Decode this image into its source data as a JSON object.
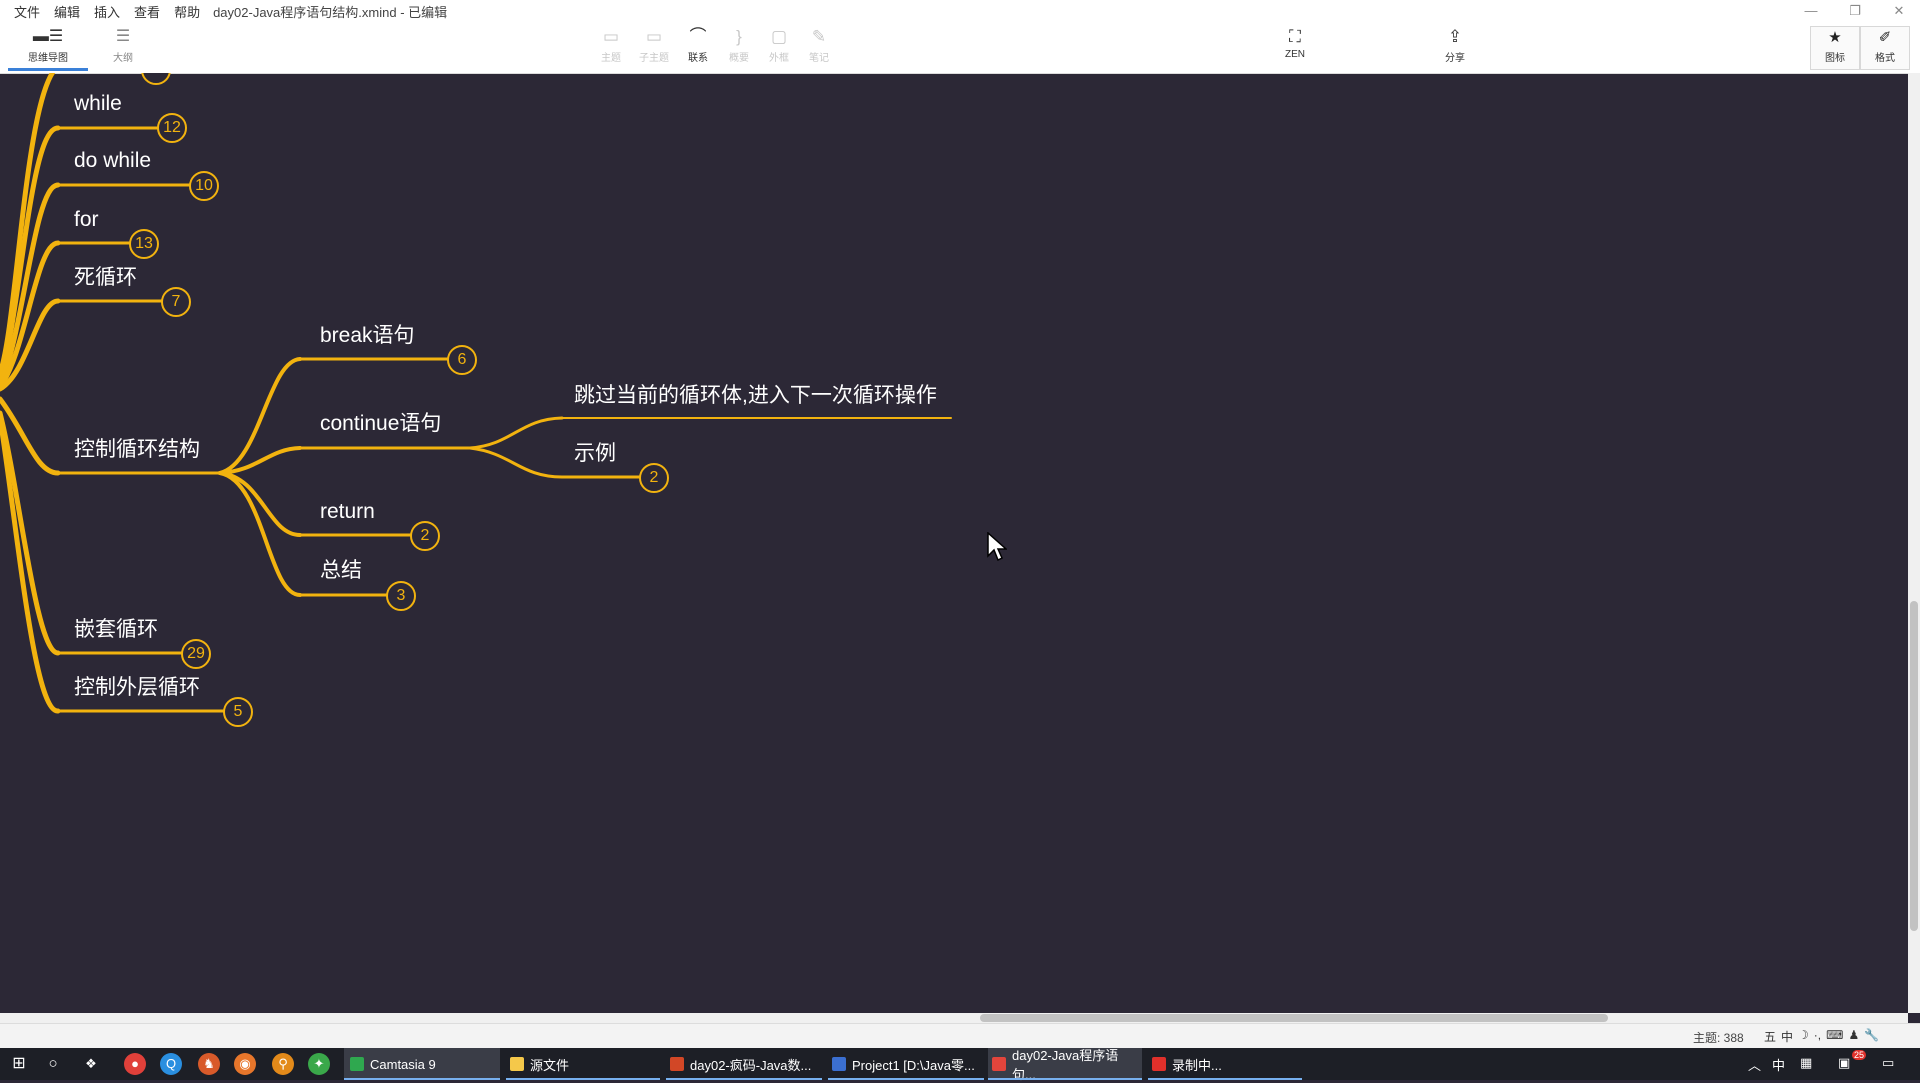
{
  "app": {
    "menu": [
      "文件",
      "编辑",
      "插入",
      "查看",
      "帮助"
    ],
    "doc_title": "day02-Java程序语句结构.xmind - 已编辑"
  },
  "toolbar": {
    "view_tabs": [
      {
        "label": "思维导图",
        "icon": "mindmap-icon",
        "active": true
      },
      {
        "label": "大纲",
        "icon": "outline-icon",
        "active": false
      }
    ],
    "tools": [
      {
        "label": "主题",
        "icon": "topic-icon",
        "enabled": false
      },
      {
        "label": "子主题",
        "icon": "subtopic-icon",
        "enabled": false
      },
      {
        "label": "联系",
        "icon": "relationship-icon",
        "enabled": true
      },
      {
        "label": "概要",
        "icon": "summary-icon",
        "enabled": false
      },
      {
        "label": "外框",
        "icon": "boundary-icon",
        "enabled": false
      },
      {
        "label": "笔记",
        "icon": "notes-icon",
        "enabled": false
      }
    ],
    "zen_label": "ZEN",
    "share_label": "分享",
    "icons_label": "图标",
    "format_label": "格式"
  },
  "mindmap": {
    "branch_color": "#f2b30f",
    "background": "#2c2836",
    "nodes": [
      {
        "id": "while",
        "label": "while",
        "badge": "12"
      },
      {
        "id": "dowhile",
        "label": "do while",
        "badge": "10"
      },
      {
        "id": "for",
        "label": "for",
        "badge": "13"
      },
      {
        "id": "deadloop",
        "label": "死循环",
        "badge": "7"
      },
      {
        "id": "control",
        "label": "控制循环结构",
        "badge": ""
      },
      {
        "id": "break",
        "label": "break语句",
        "badge": "6"
      },
      {
        "id": "continue",
        "label": "continue语句",
        "badge": ""
      },
      {
        "id": "skip",
        "label": "跳过当前的循环体,进入下一次循环操作",
        "badge": ""
      },
      {
        "id": "example",
        "label": "示例",
        "badge": "2"
      },
      {
        "id": "return",
        "label": "return",
        "badge": "2"
      },
      {
        "id": "summary",
        "label": "总结",
        "badge": "3"
      },
      {
        "id": "nested",
        "label": "嵌套循环",
        "badge": "29"
      },
      {
        "id": "outer",
        "label": "控制外层循环",
        "badge": "5"
      }
    ]
  },
  "statusbar": {
    "topic_count": "主题: 388",
    "ime": [
      "五",
      "中",
      "☽",
      "·,",
      "⌨",
      "♟",
      "🔧"
    ]
  },
  "taskbar": {
    "apps": [
      {
        "label": "Camtasia 9",
        "color": "#2fa84f"
      },
      {
        "label": "源文件",
        "color": "#f5c84a"
      },
      {
        "label": "day02-疯码-Java数...",
        "color": "#d24726"
      },
      {
        "label": "Project1 [D:\\Java零...",
        "color": "#3b6fd1"
      },
      {
        "label": "day02-Java程序语句...",
        "color": "#e2453c"
      },
      {
        "label": "录制中...",
        "color": "#e0302b"
      }
    ],
    "tray_ime": "中",
    "notification_count": "25"
  }
}
